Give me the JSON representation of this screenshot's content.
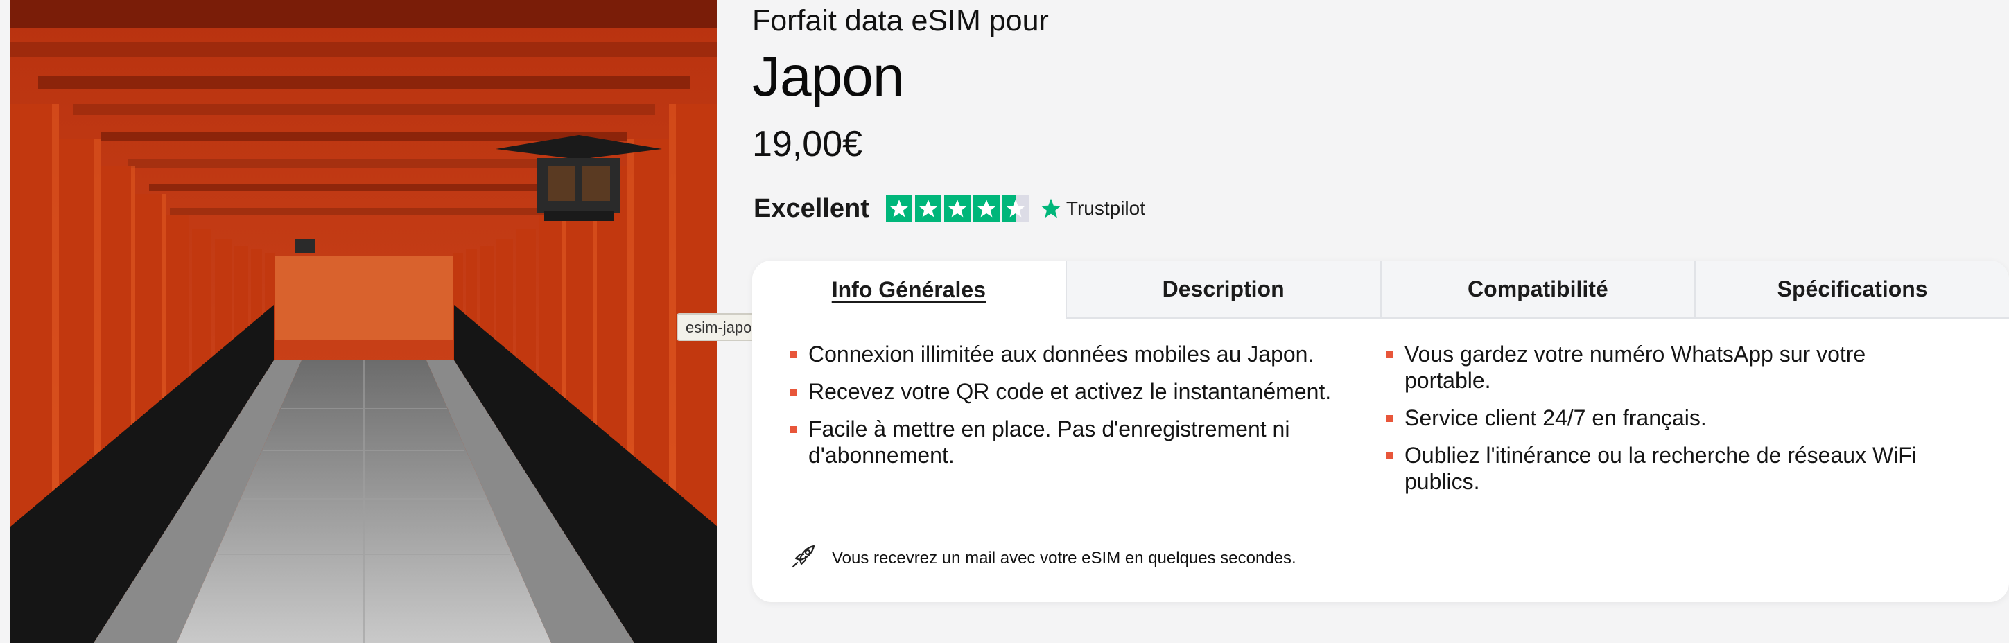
{
  "image": {
    "alt": "esim-japon",
    "tooltip": "esim-japon"
  },
  "product": {
    "subtitle": "Forfait data eSIM pour",
    "title": "Japon",
    "price": "19,00€"
  },
  "rating": {
    "label": "Excellent",
    "stars": 4.5,
    "provider": "Trustpilot",
    "color": "#00b67a"
  },
  "tabs": [
    {
      "label": "Info Générales",
      "active": true
    },
    {
      "label": "Description",
      "active": false
    },
    {
      "label": "Compatibilité",
      "active": false
    },
    {
      "label": "Spécifications",
      "active": false
    }
  ],
  "features": {
    "left": [
      "Connexion illimitée aux données mobiles au Japon.",
      "Recevez votre QR code et activez le instantanément.",
      "Facile à mettre en place. Pas d'enregistrement ni d'abonnement."
    ],
    "right": [
      "Vous gardez votre numéro WhatsApp sur votre portable.",
      "Service client 24/7 en français.",
      "Oubliez l'itinérance ou la recherche de réseaux WiFi publics."
    ],
    "bullet_color": "#e8563a"
  },
  "notice": {
    "icon": "rocket-icon",
    "text": "Vous recevrez un mail avec votre eSIM en quelques secondes."
  }
}
